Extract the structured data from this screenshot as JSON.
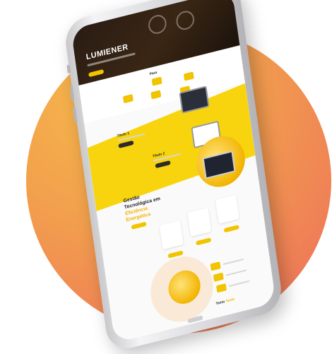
{
  "screen": {
    "brand": "LUMIENER",
    "services_heading": "Para",
    "section1_title": "Título 1",
    "section2_title": "Título 2",
    "feature_heading_line1": "Gestão",
    "feature_heading_line2": "Tecnológica em",
    "feature_heading_accent1": "Eficiência",
    "feature_heading_accent2": "Energética",
    "footer_title": "Texto",
    "footer_accent": "Texto"
  },
  "colors": {
    "orb_start": "#f6b84a",
    "orb_end": "#ea6e5b",
    "brand_yellow": "#f7d40d",
    "hero_dark": "#2a1c14"
  }
}
